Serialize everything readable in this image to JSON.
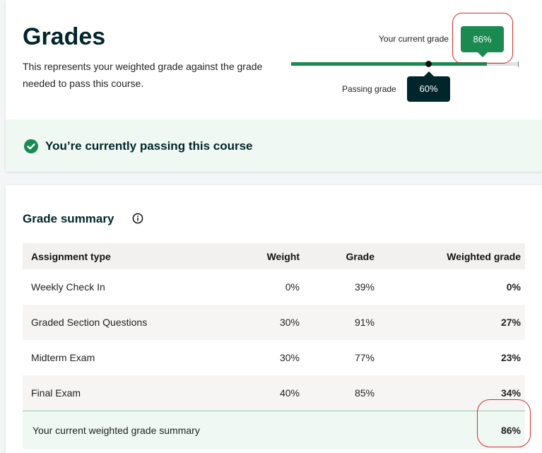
{
  "header": {
    "title": "Grades",
    "description": "This represents your weighted grade against the grade needed to pass this course."
  },
  "progress": {
    "current_label": "Your current grade",
    "current_value": "86%",
    "current_fraction": 0.86,
    "passing_label": "Passing grade",
    "passing_value": "60%",
    "passing_fraction": 0.6
  },
  "status": {
    "icon": "check-circle-icon",
    "text": "You’re currently passing this course"
  },
  "summary": {
    "title": "Grade summary",
    "info_icon": "info-icon",
    "columns": [
      "Assignment type",
      "Weight",
      "Grade",
      "Weighted grade"
    ],
    "rows": [
      {
        "type": "Weekly Check In",
        "weight": "0%",
        "grade": "39%",
        "weighted": "0%"
      },
      {
        "type": "Graded Section Questions",
        "weight": "30%",
        "grade": "91%",
        "weighted": "27%"
      },
      {
        "type": "Midterm Exam",
        "weight": "30%",
        "grade": "77%",
        "weighted": "23%"
      },
      {
        "type": "Final Exam",
        "weight": "40%",
        "grade": "85%",
        "weighted": "34%"
      }
    ],
    "footer_label": "Your current weighted grade summary",
    "footer_value": "86%"
  },
  "colors": {
    "passing_green": "#1a8a51",
    "dark_teal": "#00262b",
    "annotation_red": "#d52a2a",
    "banner_bg": "#f0f8f4"
  }
}
